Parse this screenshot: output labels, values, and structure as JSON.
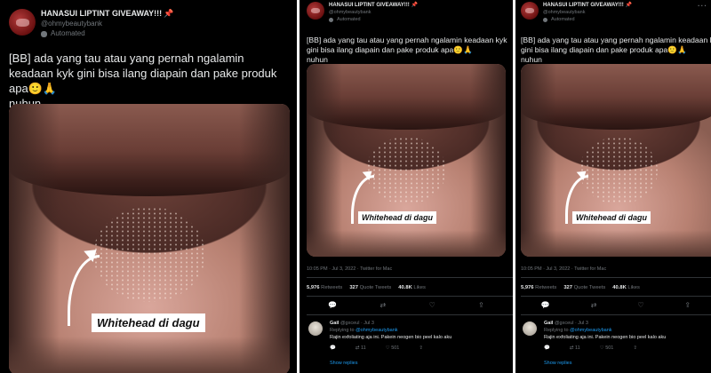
{
  "account": {
    "name": "HANASUI LIPTINT GIVEAWAY!!!",
    "pin": "📌",
    "handle": "@ohmybeautybank",
    "automated": "Automated"
  },
  "tweet": {
    "text": "[BB] ada yang tau atau yang pernah ngalamin keadaan kyk gini bisa ilang diapain dan pake produk apa",
    "emojis": "🙂🙏",
    "text_end": "nuhun",
    "image_label": "Whitehead di dagu",
    "timestamp": "10:05 PM · Jul 3, 2022 · Twitter for Mac",
    "retweets_count": "5,976",
    "retweets_label": "Retweets",
    "quotes_count": "327",
    "quotes_label": "Quote Tweets",
    "likes_count": "40.8K",
    "likes_label": "Likes",
    "more_icon": "···"
  },
  "reply": {
    "name": "Gail",
    "handle": "@gxceul · Jul 3",
    "replying_to_prefix": "Replying to",
    "replying_to": "@ohmybeautybank",
    "text": "Rajin exfoliating aja ini. Pakein neogen bio peel kalo aku",
    "retweets": "11",
    "likes": "501",
    "show_replies": "Show replies"
  },
  "icons": {
    "reply": "💬",
    "retweet": "⇄",
    "like": "♡",
    "share": "⇪"
  }
}
